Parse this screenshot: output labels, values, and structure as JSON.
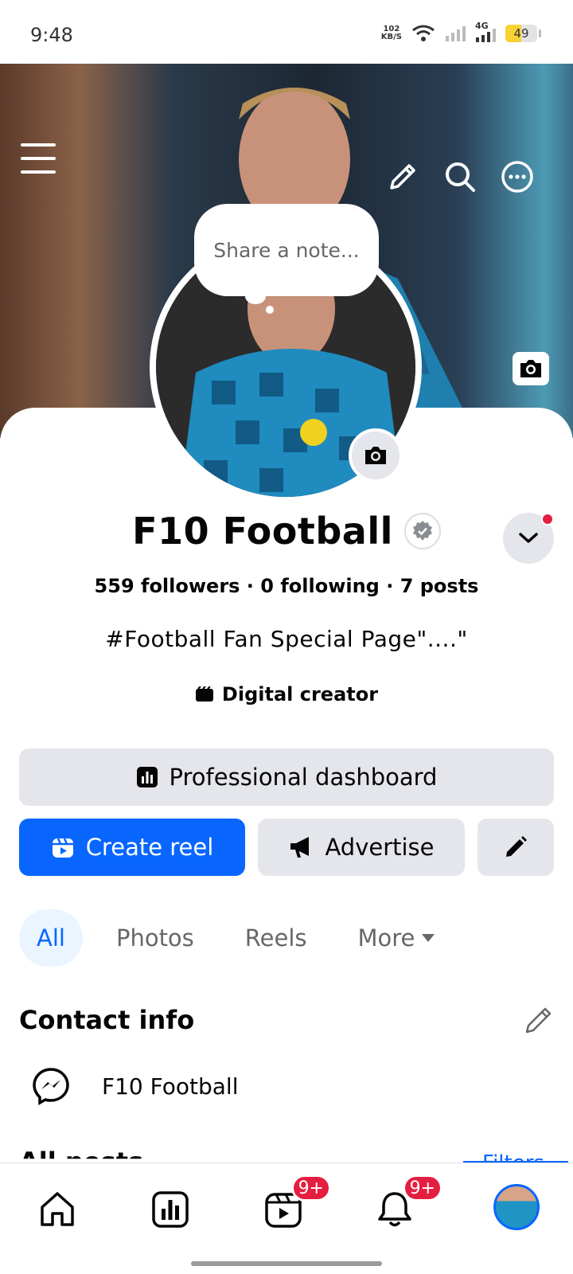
{
  "status_bar": {
    "time": "9:48",
    "net_speed_value": "102",
    "net_speed_unit": "KB/S",
    "network_type": "4G",
    "battery_level": "49",
    "battery_fraction": 0.49
  },
  "cover": {
    "icons": [
      "menu-icon",
      "edit-icon",
      "search-icon",
      "more-icon",
      "camera-icon"
    ]
  },
  "note": {
    "placeholder": "Share a note..."
  },
  "profile": {
    "name": "F10 Football",
    "stats": "559 followers · 0 following · 7 posts",
    "bio": "#Football Fan Special Page\"....\"",
    "category": "Digital creator"
  },
  "buttons": {
    "dashboard": "Professional dashboard",
    "create_reel": "Create reel",
    "advertise": "Advertise"
  },
  "tabs": [
    {
      "label": "All"
    },
    {
      "label": "Photos"
    },
    {
      "label": "Reels"
    },
    {
      "label": "More"
    }
  ],
  "contact": {
    "title": "Contact info",
    "messenger": "F10 Football"
  },
  "peek": {
    "all_posts": "All posts",
    "filters": "Filters"
  },
  "bottom_nav": {
    "reels_badge": "9+",
    "notifications_badge": "9+"
  },
  "colors": {
    "accent": "#0866ff",
    "badge": "#e41e3f",
    "button_gray": "#e4e6eb"
  }
}
